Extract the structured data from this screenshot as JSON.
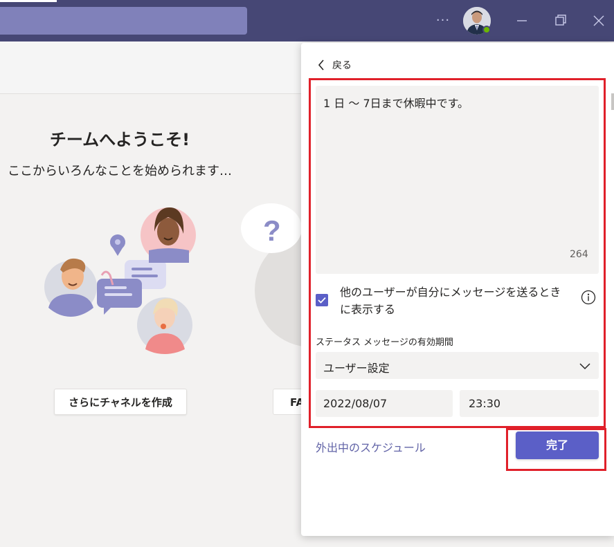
{
  "titlebar": {
    "more_glyph": "···",
    "icons": [
      "more-icon",
      "avatar",
      "minimize-icon",
      "maximize-icon",
      "close-icon"
    ],
    "bar_color": "#464775"
  },
  "welcome": {
    "title": "チームへようこそ!",
    "subtitle": "ここからいろんなことを始められます…",
    "create_channel_button": "さらにチャネルを作成",
    "faq_button": "FA"
  },
  "status_panel": {
    "back_label": "戻る",
    "message_text": "1 日 ～ 7日まで休暇中です。",
    "char_count": "264",
    "show_checkbox_checked": true,
    "show_checkbox_label": "他のユーザーが自分にメッセージを送るときに表示する",
    "expiry_label": "ステータス メッセージの有効期間",
    "expiry_dropdown_value": "ユーザー設定",
    "date_value": "2022/08/07",
    "time_value": "23:30",
    "schedule_link": "外出中のスケジュール",
    "done_button": "完了"
  },
  "colors": {
    "accent": "#5b5fc7",
    "link": "#6264a7",
    "highlight_frame": "#e0202a"
  }
}
